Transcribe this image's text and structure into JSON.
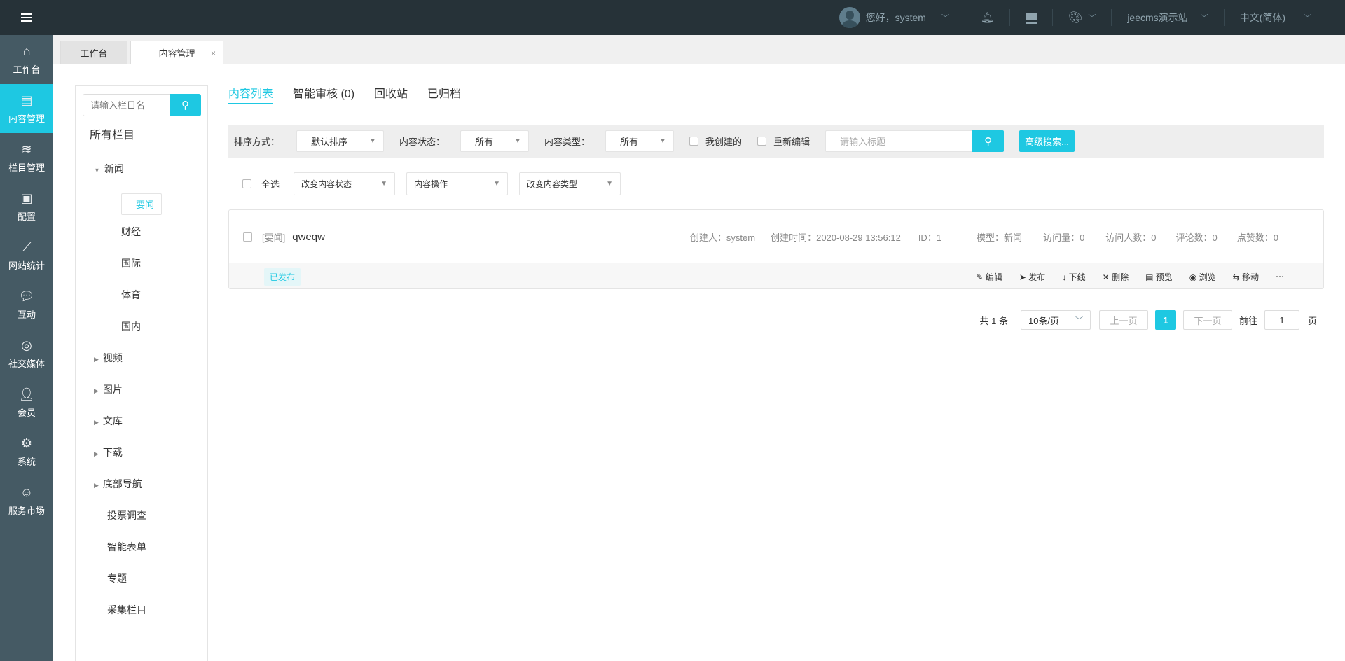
{
  "topbar": {
    "greeting": "您好，system",
    "site": "jeecms演示站",
    "language": "中文(简体)"
  },
  "sidebar": {
    "items": [
      {
        "label": "工作台",
        "icon": "home-icon"
      },
      {
        "label": "内容管理",
        "icon": "document-icon"
      },
      {
        "label": "栏目管理",
        "icon": "layers-icon"
      },
      {
        "label": "配置",
        "icon": "box-icon"
      },
      {
        "label": "网站统计",
        "icon": "chart-icon"
      },
      {
        "label": "互动",
        "icon": "chat-icon"
      },
      {
        "label": "社交媒体",
        "icon": "target-icon"
      },
      {
        "label": "会员",
        "icon": "user-icon"
      },
      {
        "label": "系统",
        "icon": "gear-icon"
      },
      {
        "label": "服务市场",
        "icon": "support-icon"
      }
    ]
  },
  "tabs": {
    "workbench": "工作台",
    "content": "内容管理",
    "close": "×"
  },
  "tree": {
    "placeholder": "请输入栏目名",
    "all": "所有栏目",
    "news": "新闻",
    "news_children": [
      "要闻",
      "财经",
      "国际",
      "体育",
      "国内"
    ],
    "collapsed": [
      "视频",
      "图片",
      "文库",
      "下载",
      "底部导航"
    ],
    "leaves": [
      "投票调查",
      "智能表单",
      "专题",
      "采集栏目"
    ]
  },
  "content_tabs": [
    "内容列表",
    "智能审核 (0)",
    "回收站",
    "已归档"
  ],
  "filter": {
    "sort_label": "排序方式：",
    "sort_value": "默认排序",
    "status_label": "内容状态：",
    "status_value": "所有",
    "type_label": "内容类型：",
    "type_value": "所有",
    "mine": "我创建的",
    "reedit": "重新编辑",
    "title_placeholder": "请输入标题",
    "advanced": "高级搜索..."
  },
  "batch": {
    "select_all": "全选",
    "change_status": "改变内容状态",
    "operation": "内容操作",
    "change_type": "改变内容类型"
  },
  "item": {
    "channel": "[要闻]",
    "title": "qweqw",
    "creator": "创建人：system",
    "created": "创建时间：2020-08-29 13:56:12",
    "id": "ID：1",
    "model": "模型：新闻",
    "views": "访问量：0",
    "visitors": "访问人数：0",
    "comments": "评论数：0",
    "likes": "点赞数：0",
    "status": "已发布",
    "actions": [
      "编辑",
      "发布",
      "下线",
      "删除",
      "预览",
      "浏览",
      "移动"
    ],
    "more": "···"
  },
  "pager": {
    "total": "共 1 条",
    "size": "10条/页",
    "prev": "上一页",
    "current": "1",
    "next": "下一页",
    "goto": "前往",
    "goto_value": "1",
    "page": "页"
  }
}
